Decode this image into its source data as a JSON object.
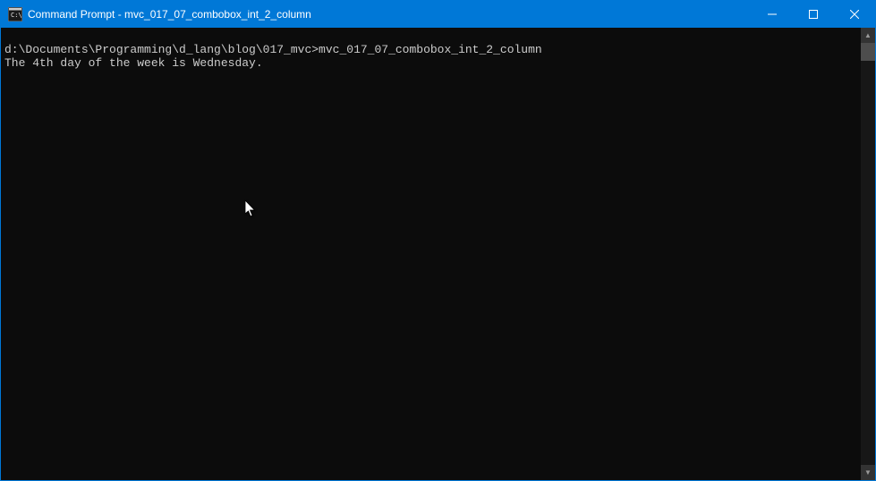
{
  "titlebar": {
    "title": "Command Prompt - mvc_017_07_combobox_int_2_column"
  },
  "terminal": {
    "lines": [
      "",
      "d:\\Documents\\Programming\\d_lang\\blog\\017_mvc>mvc_017_07_combobox_int_2_column",
      "The 4th day of the week is Wednesday."
    ]
  },
  "colors": {
    "accent": "#0078d7",
    "terminal_bg": "#0c0c0c",
    "terminal_fg": "#cccccc"
  }
}
